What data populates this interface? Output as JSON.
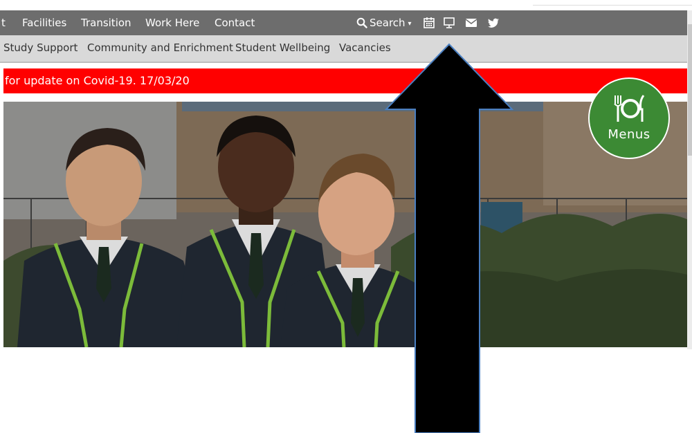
{
  "topnav": {
    "items": [
      {
        "label": "t"
      },
      {
        "label": "Facilities"
      },
      {
        "label": "Transition"
      },
      {
        "label": "Work Here"
      },
      {
        "label": "Contact"
      }
    ],
    "search_label": "Search",
    "icons": [
      "calendar-icon",
      "monitor-icon",
      "mail-icon",
      "twitter-icon"
    ]
  },
  "subnav": {
    "items": [
      {
        "label": "Study Support"
      },
      {
        "label": "Community and Enrichment"
      },
      {
        "label": "Student Wellbeing"
      },
      {
        "label": "Vacancies"
      }
    ]
  },
  "alert": {
    "text": "for update on Covid-19. 17/03/20"
  },
  "menus_badge": {
    "label": "Menus"
  },
  "colors": {
    "topbar": "#6d6d6d",
    "subnav": "#d9d9d9",
    "alert": "#ff0000",
    "menus_badge": "#3c8a34",
    "arrow": "#000000",
    "arrow_outline": "#4a7fc1"
  }
}
